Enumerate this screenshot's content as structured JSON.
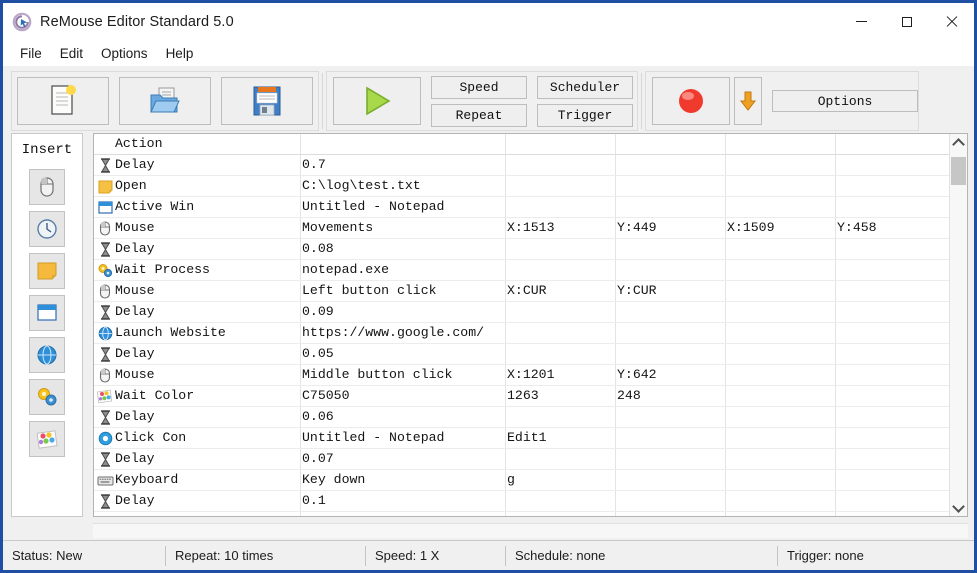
{
  "window": {
    "title": "ReMouse Editor Standard 5.0",
    "app_icon": "remouse-logo-icon",
    "minimize": "minimize-icon",
    "maximize": "maximize-icon",
    "close": "close-icon",
    "border_color": "#1f4fa3"
  },
  "menubar": {
    "items": [
      {
        "label": "File"
      },
      {
        "label": "Edit"
      },
      {
        "label": "Options"
      },
      {
        "label": "Help"
      }
    ]
  },
  "toolbar": {
    "new_label": "New",
    "open_label": "Open",
    "save_label": "Save",
    "play_label": "Play",
    "record_label": "Record",
    "insert_arrow_label": "Insert",
    "buttons": [
      {
        "label": "Speed"
      },
      {
        "label": "Scheduler"
      },
      {
        "label": "Repeat"
      },
      {
        "label": "Trigger"
      }
    ],
    "options_label": "Options",
    "icons": {
      "new": "new-document-icon",
      "open": "open-folder-icon",
      "save": "floppy-save-icon",
      "play": "play-triangle-icon",
      "record": "record-circle-icon",
      "arrow": "down-arrow-icon"
    }
  },
  "sidebar": {
    "title": "Insert",
    "items": [
      {
        "name": "insert-mouse",
        "icon": "mouse-icon"
      },
      {
        "name": "insert-delay",
        "icon": "clock-icon"
      },
      {
        "name": "insert-open-file",
        "icon": "folder-note-icon"
      },
      {
        "name": "insert-active-window",
        "icon": "window-icon"
      },
      {
        "name": "insert-launch-website",
        "icon": "globe-icon"
      },
      {
        "name": "insert-wait-process",
        "icon": "gears-icon"
      },
      {
        "name": "insert-wait-color",
        "icon": "color-palette-icon"
      }
    ]
  },
  "list": {
    "header": {
      "action": "Action",
      "value": "",
      "p1": "",
      "p2": "",
      "p3": "",
      "p4": ""
    },
    "rows": [
      {
        "icon": "hourglass-icon",
        "action": "Delay",
        "value": "0.7",
        "p1": "",
        "p2": "",
        "p3": "",
        "p4": ""
      },
      {
        "icon": "folder-note-icon",
        "action": "Open",
        "value": "C:\\log\\test.txt",
        "p1": "",
        "p2": "",
        "p3": "",
        "p4": ""
      },
      {
        "icon": "window-icon",
        "action": "Active Win",
        "value": "Untitled - Notepad",
        "p1": "",
        "p2": "",
        "p3": "",
        "p4": ""
      },
      {
        "icon": "mouse-icon",
        "action": "Mouse",
        "value": "Movements",
        "p1": "X:1513",
        "p2": "Y:449",
        "p3": "X:1509",
        "p4": "Y:458"
      },
      {
        "icon": "hourglass-icon",
        "action": "Delay",
        "value": "0.08",
        "p1": "",
        "p2": "",
        "p3": "",
        "p4": ""
      },
      {
        "icon": "gears-icon",
        "action": "Wait Process",
        "value": "notepad.exe",
        "p1": "",
        "p2": "",
        "p3": "",
        "p4": ""
      },
      {
        "icon": "mouse-icon",
        "action": "Mouse",
        "value": "Left button click",
        "p1": "X:CUR",
        "p2": "Y:CUR",
        "p3": "",
        "p4": ""
      },
      {
        "icon": "hourglass-icon",
        "action": "Delay",
        "value": "0.09",
        "p1": "",
        "p2": "",
        "p3": "",
        "p4": ""
      },
      {
        "icon": "globe-icon",
        "action": "Launch Website",
        "value": "https://www.google.com/",
        "p1": "",
        "p2": "",
        "p3": "",
        "p4": ""
      },
      {
        "icon": "hourglass-icon",
        "action": "Delay",
        "value": "0.05",
        "p1": "",
        "p2": "",
        "p3": "",
        "p4": ""
      },
      {
        "icon": "mouse-icon",
        "action": "Mouse",
        "value": "Middle button click",
        "p1": "X:1201",
        "p2": "Y:642",
        "p3": "",
        "p4": ""
      },
      {
        "icon": "color-palette-icon",
        "action": "Wait Color",
        "value": "C75050",
        "p1": "1263",
        "p2": "248",
        "p3": "",
        "p4": ""
      },
      {
        "icon": "hourglass-icon",
        "action": "Delay",
        "value": "0.06",
        "p1": "",
        "p2": "",
        "p3": "",
        "p4": ""
      },
      {
        "icon": "target-ring-icon",
        "action": "Click Con",
        "value": "Untitled - Notepad",
        "p1": "Edit1",
        "p2": "",
        "p3": "",
        "p4": ""
      },
      {
        "icon": "hourglass-icon",
        "action": "Delay",
        "value": "0.07",
        "p1": "",
        "p2": "",
        "p3": "",
        "p4": ""
      },
      {
        "icon": "keyboard-icon",
        "action": "Keyboard",
        "value": "Key down",
        "p1": "g",
        "p2": "",
        "p3": "",
        "p4": ""
      },
      {
        "icon": "hourglass-icon",
        "action": "Delay",
        "value": "0.1",
        "p1": "",
        "p2": "",
        "p3": "",
        "p4": ""
      }
    ],
    "scrollbar": {
      "up": "chevron-up-icon",
      "down": "chevron-down-icon"
    }
  },
  "statusbar": {
    "status": "Status: New",
    "repeat": "Repeat: 10 times",
    "speed": "Speed: 1 X",
    "schedule": "Schedule: none",
    "trigger": "Trigger: none"
  }
}
